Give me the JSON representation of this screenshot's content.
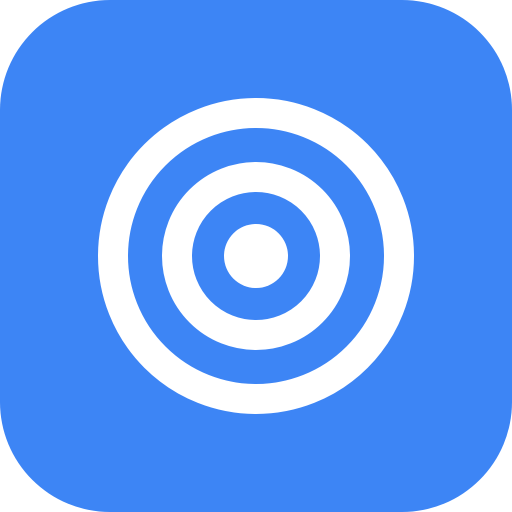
{
  "icon": {
    "semantic": "target-icon",
    "background_color": "#3D85F5",
    "foreground_color": "#FFFFFF"
  }
}
